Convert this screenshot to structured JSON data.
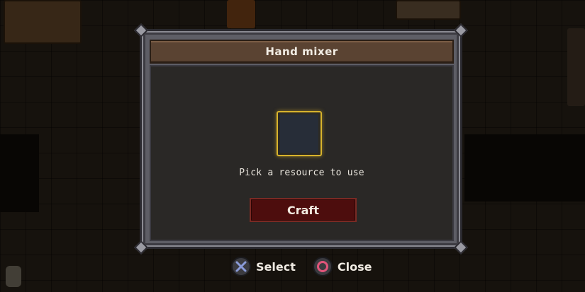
{
  "dialog": {
    "title": "Hand mixer",
    "prompt": "Pick a resource to use",
    "craft_label": "Craft"
  },
  "hints": [
    {
      "button": "cross",
      "label": "Select",
      "color": "#8a9bd8"
    },
    {
      "button": "circle",
      "label": "Close",
      "color": "#e0557a"
    }
  ],
  "colors": {
    "slot_highlight": "#d8b32c",
    "craft_button": "#4d0d0d",
    "title_bar": "#5a4332"
  }
}
